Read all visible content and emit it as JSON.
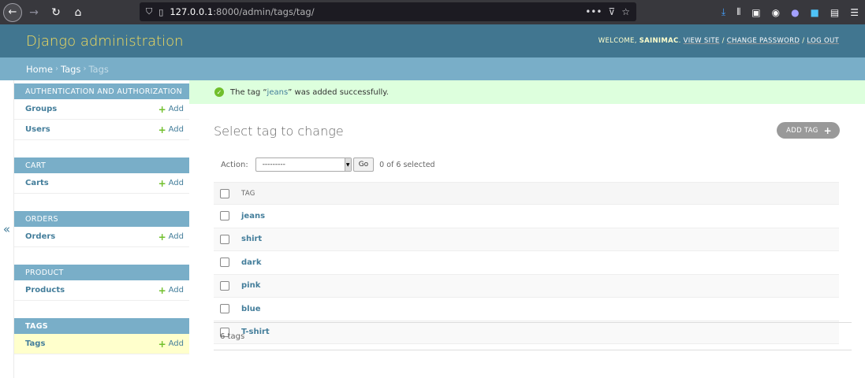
{
  "browser": {
    "url_host": "127.0.0.1",
    "url_path": ":8000/admin/tags/tag/",
    "ellipsis": "•••"
  },
  "header": {
    "brand": "Django administration",
    "welcome": "WELCOME,",
    "username": "SAINIMAC",
    "view_site": "VIEW SITE",
    "change_password": "CHANGE PASSWORD",
    "log_out": "LOG OUT",
    "sep": "/"
  },
  "breadcrumbs": {
    "home": "Home",
    "app": "Tags",
    "current": "Tags",
    "sep": "›"
  },
  "sidebar": {
    "toggle": "«",
    "add_label": "Add",
    "modules": [
      {
        "caption": "Authentication and Authorization",
        "models": [
          "Groups",
          "Users"
        ]
      },
      {
        "caption": "Cart",
        "models": [
          "Carts"
        ]
      },
      {
        "caption": "Orders",
        "models": [
          "Orders"
        ]
      },
      {
        "caption": "Product",
        "models": [
          "Products"
        ]
      },
      {
        "caption": "Tags",
        "models": [
          "Tags"
        ]
      }
    ]
  },
  "message": {
    "prefix": "The tag “",
    "link": "jeans",
    "suffix": "” was added successfully."
  },
  "content": {
    "title": "Select tag to change",
    "add_button": "Add tag",
    "action_label": "Action:",
    "action_select": "---------",
    "go_button": "Go",
    "counter": "0 of 6 selected",
    "column_header": "Tag",
    "rows": [
      "jeans",
      "shirt",
      "dark",
      "pink",
      "blue",
      "T-shirt"
    ],
    "paginator": "6 tags"
  },
  "colors": {
    "header_bg": "#417690",
    "brand": "#f5dd5d",
    "breadcrumb_bg": "#79aec8",
    "success_bg": "#ddffdd",
    "link": "#447e9b",
    "add_plus": "#70bf2b"
  }
}
